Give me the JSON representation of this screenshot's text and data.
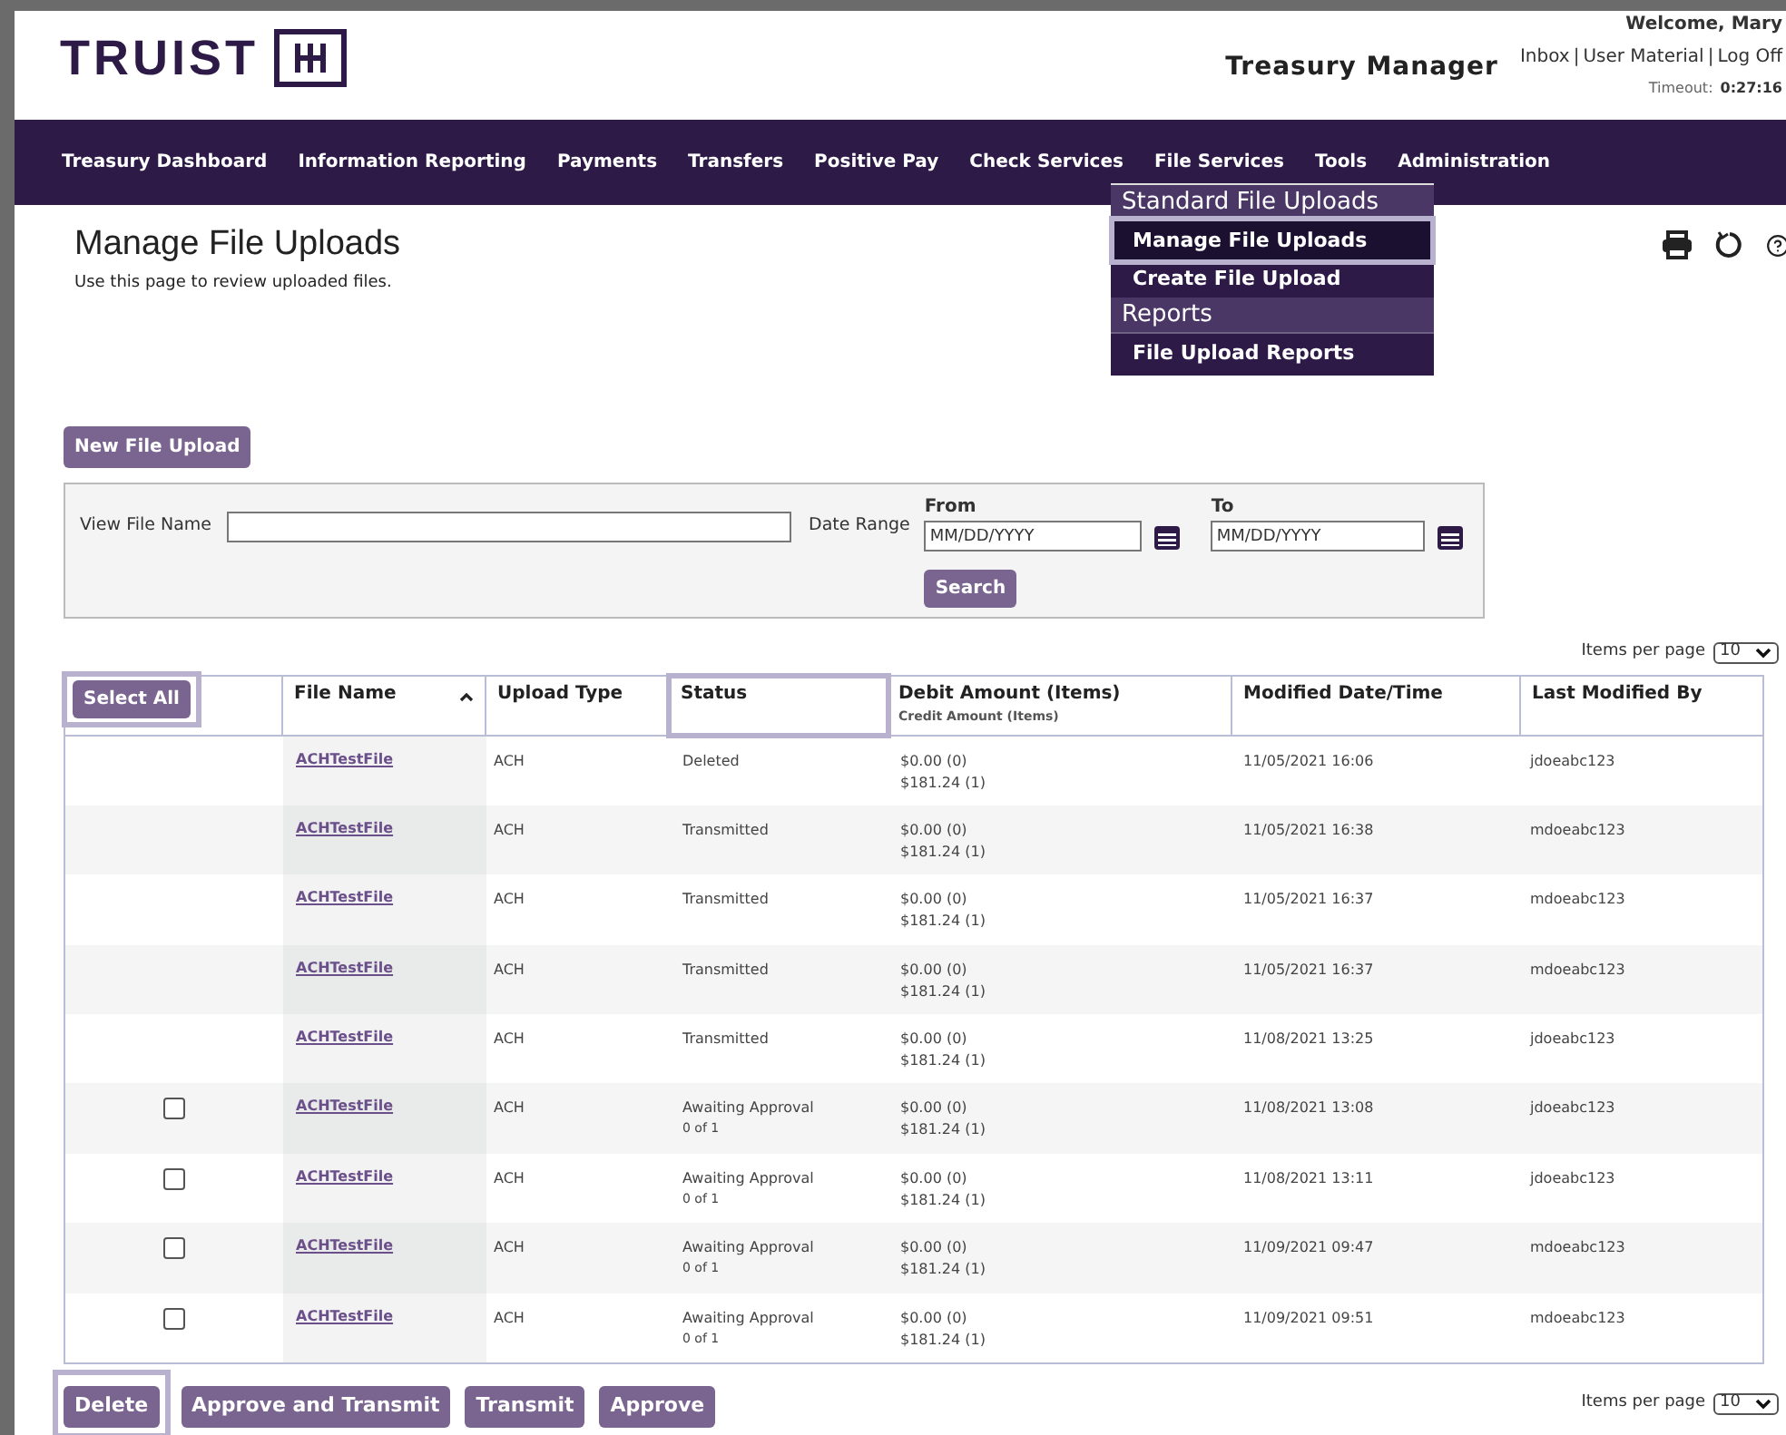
{
  "header": {
    "logo": "TRUIST",
    "product": "Treasury Manager",
    "welcome": "Welcome, Mary",
    "links": [
      {
        "label": "Inbox"
      },
      {
        "label": "User Material"
      },
      {
        "label": "Log Off"
      }
    ],
    "separator": "|",
    "timeout_label": "Timeout:",
    "timeout": "0:27:16"
  },
  "nav": [
    {
      "label": "Treasury Dashboard"
    },
    {
      "label": "Information Reporting"
    },
    {
      "label": "Payments"
    },
    {
      "label": "Transfers"
    },
    {
      "label": "Positive Pay"
    },
    {
      "label": "Check Services"
    },
    {
      "label": "File Services"
    },
    {
      "label": "Tools"
    },
    {
      "label": "Administration"
    }
  ],
  "menu": [
    {
      "kind": "heading",
      "label": "Standard File Uploads",
      "highlighted": false
    },
    {
      "kind": "item",
      "label": "Manage File Uploads",
      "highlighted": true
    },
    {
      "kind": "item",
      "label": "Create File Upload",
      "highlighted": false
    },
    {
      "kind": "heading",
      "label": "Reports",
      "highlighted": false
    },
    {
      "kind": "item",
      "label": "File Upload Reports",
      "highlighted": false
    }
  ],
  "page": {
    "title": "Manage File Uploads",
    "subtitle": "Use this page to review uploaded files."
  },
  "new_button": "New File Upload",
  "filter": {
    "file_name_label": "View File Name",
    "date_range_label": "Date Range",
    "from_label": "From",
    "from_placeholder": "MM/DD/YYYY",
    "to_label": "To",
    "to_placeholder": "MM/DD/YYYY",
    "search_button": "Search"
  },
  "items_per_page_top": {
    "label": "Items per page",
    "value": "10"
  },
  "select_all": {
    "label": "Select All",
    "highlighted": true
  },
  "columns": [
    {
      "label": "File Name",
      "sorted": true,
      "highlighted": false
    },
    {
      "label": "Upload Type",
      "sorted": false,
      "highlighted": false
    },
    {
      "label": "Status",
      "sorted": false,
      "highlighted": true
    },
    {
      "label": "Debit Amount (Items)",
      "sub": "Credit Amount (Items)",
      "sorted": false,
      "highlighted": false
    },
    {
      "label": "Modified Date/Time",
      "sorted": false,
      "highlighted": false
    },
    {
      "label": "Last Modified By",
      "sorted": false,
      "highlighted": false
    }
  ],
  "rows": [
    {
      "kind": "closed",
      "file": "ACHTestFile",
      "type": "ACH",
      "status": "Deleted",
      "debit": "$0.00 (0)",
      "credit": "$181.24 (1)",
      "modified": "11/05/2021 16:06",
      "by": "jdoeabc123"
    },
    {
      "kind": "closed",
      "file": "ACHTestFile",
      "type": "ACH",
      "status": "Transmitted",
      "debit": "$0.00 (0)",
      "credit": "$181.24 (1)",
      "modified": "11/05/2021 16:38",
      "by": "mdoeabc123"
    },
    {
      "kind": "closed",
      "file": "ACHTestFile",
      "type": "ACH",
      "status": "Transmitted",
      "debit": "$0.00 (0)",
      "credit": "$181.24 (1)",
      "modified": "11/05/2021 16:37",
      "by": "mdoeabc123"
    },
    {
      "kind": "closed",
      "file": "ACHTestFile",
      "type": "ACH",
      "status": "Transmitted",
      "debit": "$0.00 (0)",
      "credit": "$181.24 (1)",
      "modified": "11/05/2021 16:37",
      "by": "mdoeabc123"
    },
    {
      "kind": "closed",
      "file": "ACHTestFile",
      "type": "ACH",
      "status": "Transmitted",
      "debit": "$0.00 (0)",
      "credit": "$181.24 (1)",
      "modified": "11/08/2021 13:25",
      "by": "jdoeabc123"
    },
    {
      "kind": "selectable",
      "checked": false,
      "file": "ACHTestFile",
      "type": "ACH",
      "status": "Awaiting Approval",
      "approvals": "0 of 1",
      "debit": "$0.00 (0)",
      "credit": "$181.24 (1)",
      "modified": "11/08/2021 13:08",
      "by": "jdoeabc123"
    },
    {
      "kind": "selectable",
      "checked": false,
      "file": "ACHTestFile",
      "type": "ACH",
      "status": "Awaiting Approval",
      "approvals": "0 of 1",
      "debit": "$0.00 (0)",
      "credit": "$181.24 (1)",
      "modified": "11/08/2021 13:11",
      "by": "jdoeabc123"
    },
    {
      "kind": "selectable",
      "checked": false,
      "file": "ACHTestFile",
      "type": "ACH",
      "status": "Awaiting Approval",
      "approvals": "0 of 1",
      "debit": "$0.00 (0)",
      "credit": "$181.24 (1)",
      "modified": "11/09/2021 09:47",
      "by": "mdoeabc123"
    },
    {
      "kind": "selectable",
      "checked": false,
      "file": "ACHTestFile",
      "type": "ACH",
      "status": "Awaiting Approval",
      "approvals": "0 of 1",
      "debit": "$0.00 (0)",
      "credit": "$181.24 (1)",
      "modified": "11/09/2021 09:51",
      "by": "mdoeabc123"
    }
  ],
  "actions": [
    {
      "label": "Delete",
      "highlighted": true
    },
    {
      "label": "Approve and Transmit",
      "highlighted": false
    },
    {
      "label": "Transmit",
      "highlighted": false
    },
    {
      "label": "Approve",
      "highlighted": false
    }
  ],
  "items_per_page_bottom": {
    "label": "Items per page",
    "value": "10"
  }
}
